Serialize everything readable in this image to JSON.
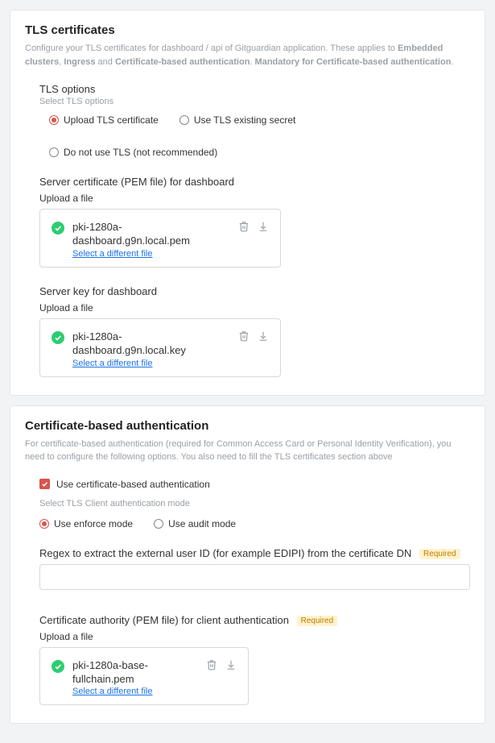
{
  "tls": {
    "title": "TLS certificates",
    "desc_pre": "Configure your TLS certificates for dashboard / api of Gitguardian application. These applies to ",
    "desc_b1": "Embedded clusters",
    "desc_mid1": ", ",
    "desc_b2": "Ingress",
    "desc_mid2": " and ",
    "desc_b3": "Certificate-based authentication",
    "desc_mid3": ". ",
    "desc_b4": "Mandatory for Certificate-based authentication",
    "desc_post": ".",
    "options": {
      "title": "TLS options",
      "sub": "Select TLS options",
      "radios": [
        {
          "label": "Upload TLS certificate",
          "selected": true
        },
        {
          "label": "Use TLS existing secret",
          "selected": false
        },
        {
          "label": "Do not use TLS (not recommended)",
          "selected": false
        }
      ]
    },
    "cert": {
      "label": "Server certificate (PEM file) for dashboard",
      "upload_label": "Upload a file",
      "filename": "pki-1280a-dashboard.g9n.local.pem",
      "link": "Select a different file"
    },
    "key": {
      "label": "Server key for dashboard",
      "upload_label": "Upload a file",
      "filename": "pki-1280a-dashboard.g9n.local.key",
      "link": "Select a different file"
    }
  },
  "cba": {
    "title": "Certificate-based authentication",
    "desc": "For certificate-based authentication (required for Common Access Card or Personal Identity Verification), you need to configure the following options. You also need to fill the TLS certificates section above",
    "checkbox_label": "Use certificate-based authentication",
    "mode_label": "Select TLS Client authentication mode",
    "mode_radios": [
      {
        "label": "Use enforce mode",
        "selected": true
      },
      {
        "label": "Use audit mode",
        "selected": false
      }
    ],
    "regex": {
      "label": "Regex to extract the external user ID (for example EDIPI) from the certificate DN",
      "required": "Required",
      "value": ""
    },
    "ca": {
      "label": "Certificate authority (PEM file) for client authentication",
      "required": "Required",
      "upload_label": "Upload a file",
      "filename": "pki-1280a-base-fullchain.pem",
      "link": "Select a different file"
    }
  }
}
